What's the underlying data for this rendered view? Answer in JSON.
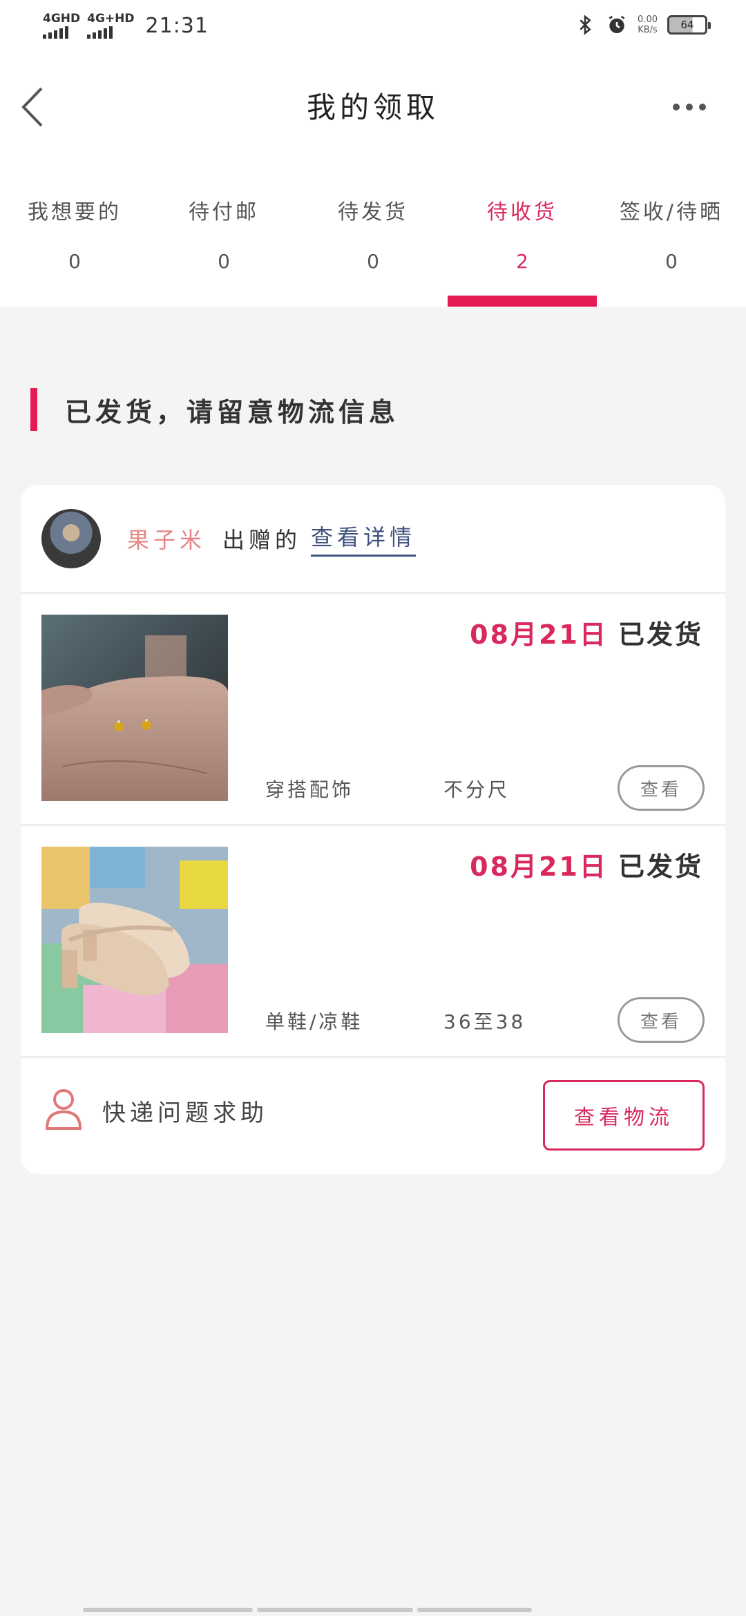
{
  "status_bar": {
    "signal_1": "4GHD",
    "signal_2": "4G+HD",
    "time": "21:31",
    "speed_value": "0.00",
    "speed_unit": "KB/s",
    "battery": "64"
  },
  "header": {
    "title": "我的领取",
    "back_icon": "chevron-left-icon",
    "more_icon": "more-horizontal-icon"
  },
  "tabs": [
    {
      "label": "我想要的",
      "count": "0",
      "active": false
    },
    {
      "label": "待付邮",
      "count": "0",
      "active": false
    },
    {
      "label": "待发货",
      "count": "0",
      "active": false
    },
    {
      "label": "待收货",
      "count": "2",
      "active": true
    },
    {
      "label": "签收/待晒",
      "count": "0",
      "active": false
    }
  ],
  "section": {
    "heading": "已发货，请留意物流信息"
  },
  "card": {
    "giver": {
      "name": "果子米",
      "suffix": "出赠的",
      "link": "查看详情"
    },
    "items": [
      {
        "date": "08月21日",
        "state": "已发货",
        "category": "穿搭配饰",
        "size": "不分尺",
        "view_label": "查看",
        "photo": "earrings-photo"
      },
      {
        "date": "08月21日",
        "state": "已发货",
        "category": "单鞋/凉鞋",
        "size": "36至38",
        "view_label": "查看",
        "photo": "shoes-photo"
      }
    ],
    "help_text": "快递问题求助",
    "logistics_label": "查看物流"
  },
  "colors": {
    "accent": "#e41c53",
    "link": "#3f5280",
    "giver_name": "#e48585",
    "background": "#f4f4f4"
  }
}
